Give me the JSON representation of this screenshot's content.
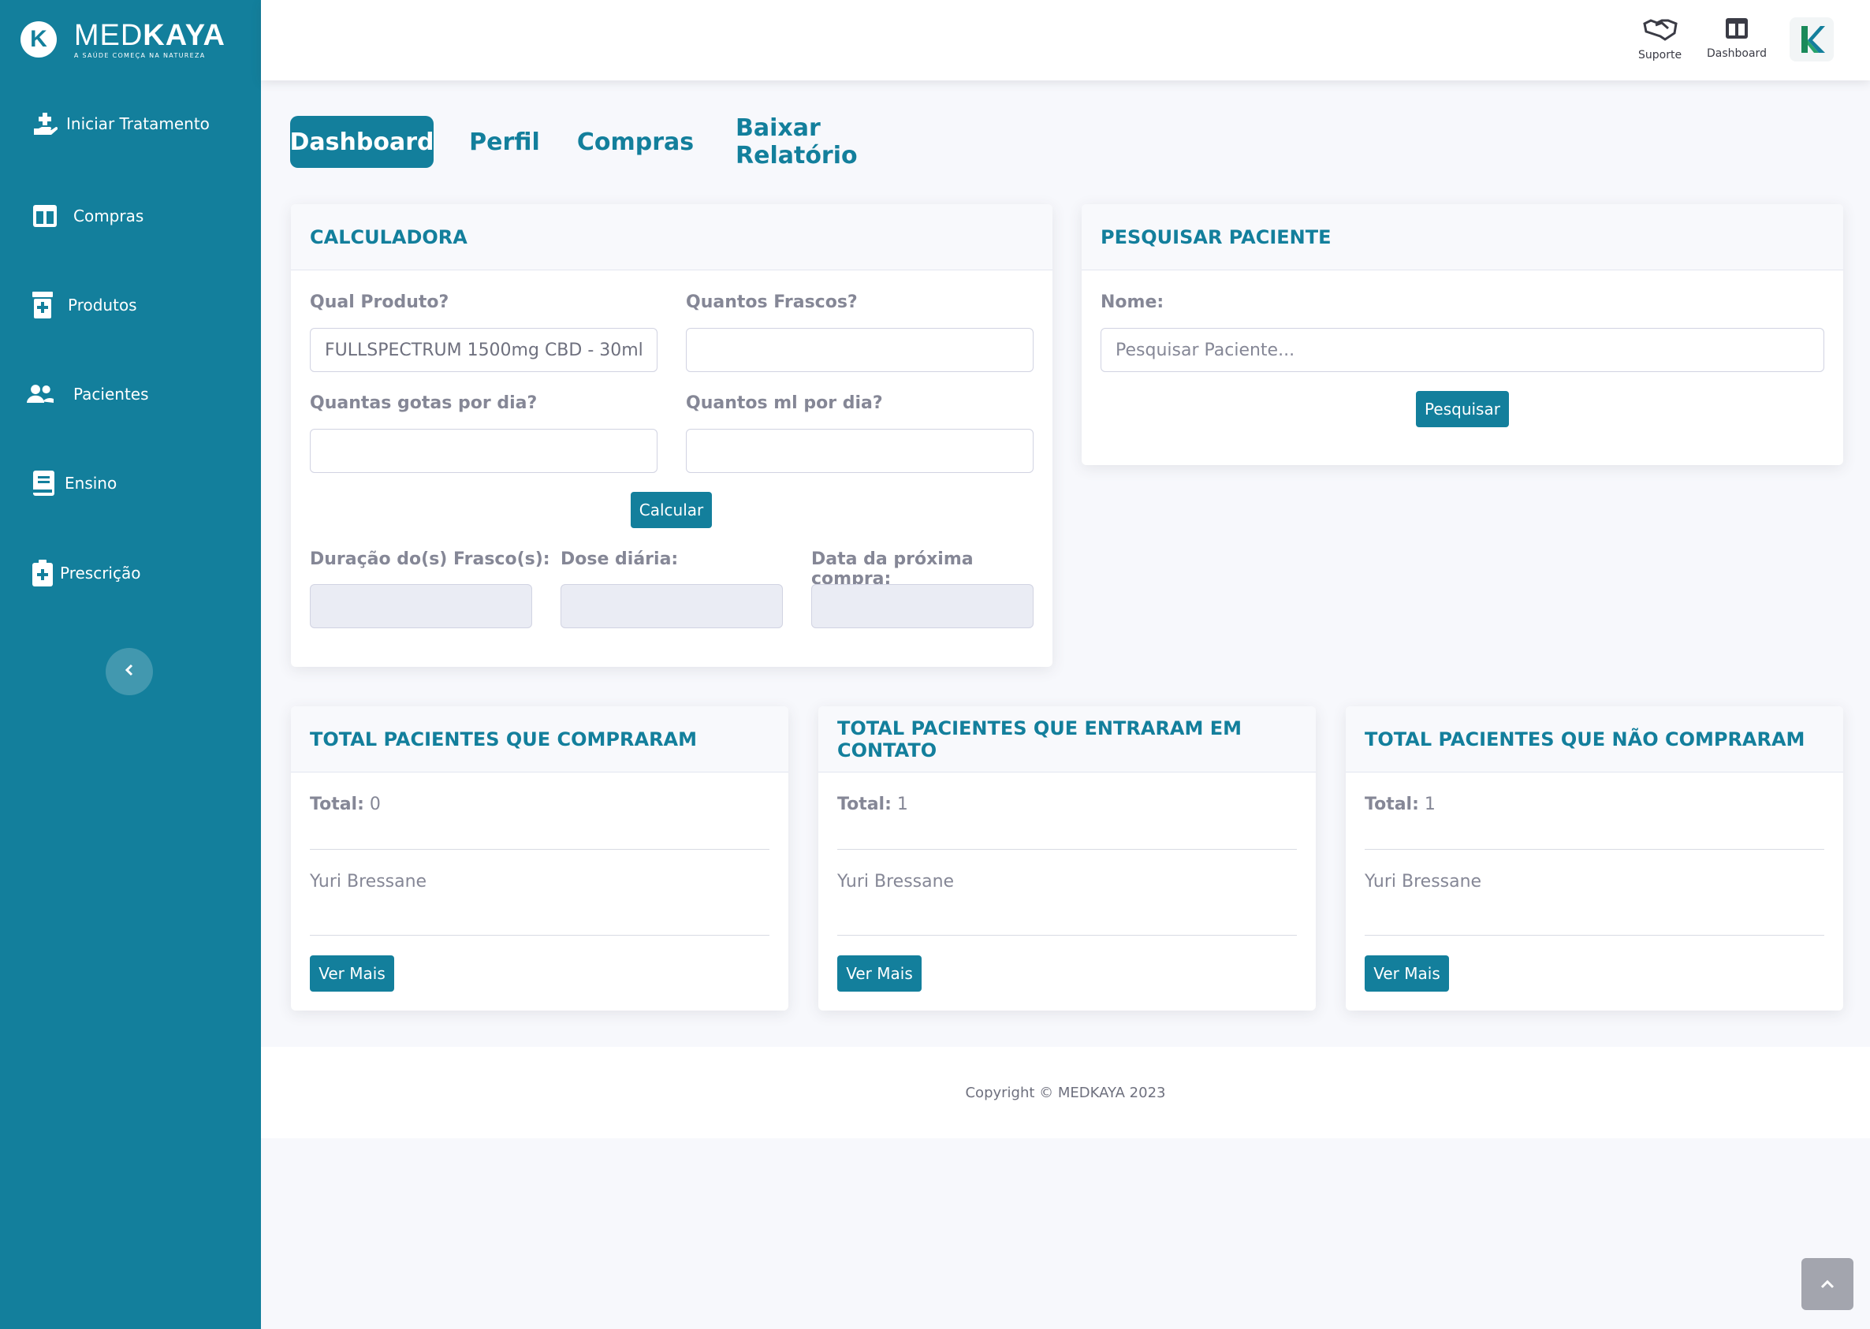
{
  "brand": {
    "name_thin": "MED",
    "name_bold": "KAYA",
    "tagline": "A SAÚDE COMEÇA NA NATUREZA",
    "logo_letter": "K"
  },
  "sidebar": {
    "items": [
      {
        "label": "Iniciar Tratamento",
        "icon": "hand-plus-icon"
      },
      {
        "label": "Compras",
        "icon": "columns-icon"
      },
      {
        "label": "Produtos",
        "icon": "prescription-bottle-icon"
      },
      {
        "label": "Pacientes",
        "icon": "users-icon"
      },
      {
        "label": "Ensino",
        "icon": "book-icon"
      },
      {
        "label": "Prescrição",
        "icon": "file-medical-icon"
      }
    ],
    "toggle_icon": "chevron-left-icon"
  },
  "topbar": {
    "support_label": "Suporte",
    "dashboard_label": "Dashboard",
    "avatar_letter": "K"
  },
  "tabs": [
    {
      "label": "Dashboard",
      "active": true
    },
    {
      "label": "Perfil",
      "active": false
    },
    {
      "label": "Compras",
      "active": false
    },
    {
      "label": "Baixar Relatório",
      "active": false
    }
  ],
  "calculator": {
    "title": "CALCULADORA",
    "product_label": "Qual Produto?",
    "product_value": "FULLSPECTRUM 1500mg CBD - 30ml",
    "bottles_label": "Quantos Frascos?",
    "drops_label": "Quantas gotas por dia?",
    "ml_label": "Quantos ml por dia?",
    "calc_button": "Calcular",
    "duration_label": "Duração do(s) Frasco(s):",
    "daily_dose_label": "Dose diária:",
    "next_purchase_label": "Data da próxima compra:"
  },
  "search": {
    "title": "PESQUISAR PACIENTE",
    "name_label": "Nome:",
    "placeholder": "Pesquisar Paciente...",
    "button": "Pesquisar"
  },
  "stats": [
    {
      "title": "TOTAL PACIENTES QUE COMPRARAM",
      "total_label": "Total:",
      "total": "0",
      "patient": "Yuri Bressane",
      "button": "Ver Mais"
    },
    {
      "title": "TOTAL PACIENTES QUE ENTRARAM EM CONTATO",
      "total_label": "Total:",
      "total": "1",
      "patient": "Yuri Bressane",
      "button": "Ver Mais"
    },
    {
      "title": "TOTAL PACIENTES QUE NÃO COMPRARAM",
      "total_label": "Total:",
      "total": "1",
      "patient": "Yuri Bressane",
      "button": "Ver Mais"
    }
  ],
  "footer": {
    "copyright": "Copyright © MEDKAYA 2023"
  },
  "colors": {
    "primary": "#137f9c",
    "background": "#f7f8fc",
    "text_muted": "#858796"
  }
}
